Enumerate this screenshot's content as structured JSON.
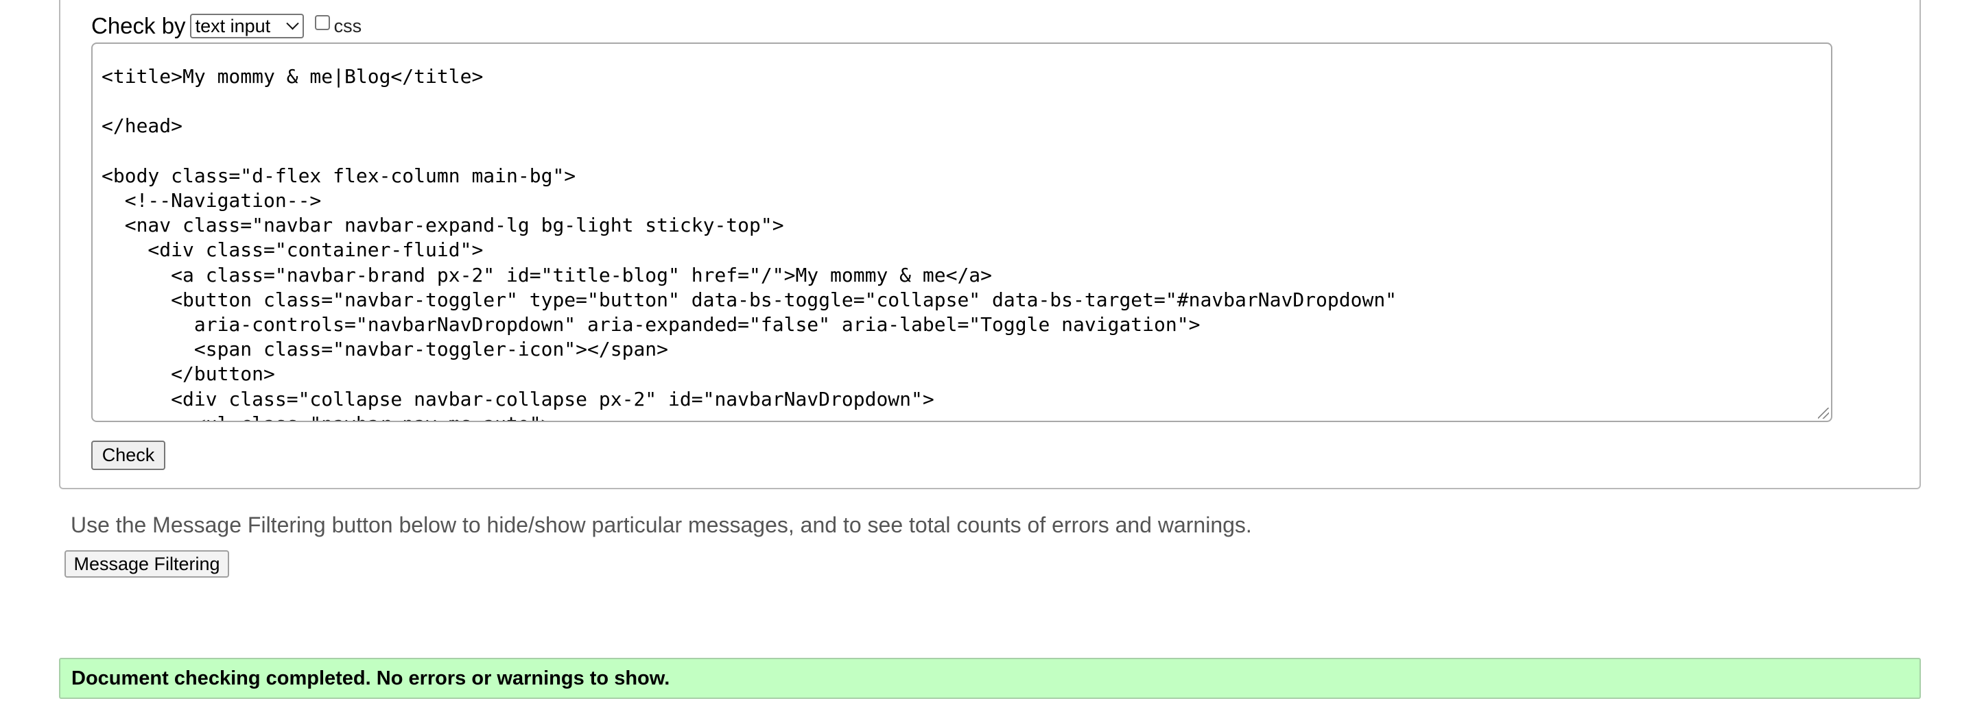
{
  "check_form": {
    "check_by_label": "Check by",
    "check_by_selected": "text input",
    "css_checkbox_label": "css",
    "css_checked": false,
    "check_button_label": "Check"
  },
  "source_text": "<title>My mommy & me|Blog</title>\n\n</head>\n\n<body class=\"d-flex flex-column main-bg\">\n  <!--Navigation-->\n  <nav class=\"navbar navbar-expand-lg bg-light sticky-top\">\n    <div class=\"container-fluid\">\n      <a class=\"navbar-brand px-2\" id=\"title-blog\" href=\"/\">My mommy & me</a>\n      <button class=\"navbar-toggler\" type=\"button\" data-bs-toggle=\"collapse\" data-bs-target=\"#navbarNavDropdown\"\n        aria-controls=\"navbarNavDropdown\" aria-expanded=\"false\" aria-label=\"Toggle navigation\">\n        <span class=\"navbar-toggler-icon\"></span>\n      </button>\n      <div class=\"collapse navbar-collapse px-2\" id=\"navbarNavDropdown\">\n        <ul class=\"navbar-nav ms-auto\">",
  "filtering": {
    "hint": "Use the Message Filtering button below to hide/show particular messages, and to see total counts of errors and warnings.",
    "button_label": "Message Filtering"
  },
  "result": {
    "message": "Document checking completed. No errors or warnings to show."
  }
}
